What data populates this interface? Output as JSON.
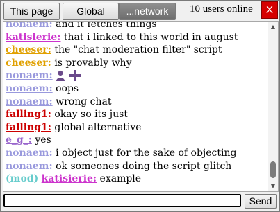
{
  "tabs": [
    {
      "label": "This page"
    },
    {
      "label": "Global"
    },
    {
      "label": "...network"
    }
  ],
  "online_text": "10 users online",
  "close_label": "X",
  "colors": {
    "nonaem": "#9999dd",
    "katisierie": "#cc33cc",
    "cheeser": "#e0a000",
    "falling1": "#cc0000",
    "e_g": "#9966cc",
    "mod": "#66cccc",
    "active_tab": "#7c7c7c",
    "close_bg": "#d60000"
  },
  "messages": [
    {
      "user": "nonaem:",
      "color": "#9999dd",
      "text": "and it fetches things"
    },
    {
      "user": "katisierie:",
      "color": "#cc33cc",
      "text": "that i linked to this world in august"
    },
    {
      "user": "cheeser:",
      "color": "#e0a000",
      "text": "the \"chat moderation filter\" script"
    },
    {
      "user": "cheeser:",
      "color": "#e0a000",
      "text": "is provably why"
    },
    {
      "user": "nonaem:",
      "color": "#9999dd",
      "icons": [
        "person-icon",
        "plus-icon"
      ]
    },
    {
      "user": "nonaem:",
      "color": "#9999dd",
      "text": "oops"
    },
    {
      "user": "nonaem:",
      "color": "#9999dd",
      "text": "wrong chat"
    },
    {
      "user": "falling1:",
      "color": "#cc0000",
      "text": "okay so its just"
    },
    {
      "user": "falling1:",
      "color": "#cc0000",
      "text": "global alternative"
    },
    {
      "user": "e_g_:",
      "color": "#9966cc",
      "text": "yes"
    },
    {
      "user": "nonaem:",
      "color": "#9999dd",
      "text": "i object just for the sake of objecting"
    },
    {
      "user": "nonaem:",
      "color": "#9999dd",
      "text": "ok someones doing the script glitch"
    },
    {
      "prefix": "(mod)",
      "user": "katisierie:",
      "color": "#cc33cc",
      "text": "example"
    }
  ],
  "input": {
    "value": "",
    "placeholder": ""
  },
  "send_label": "Send"
}
